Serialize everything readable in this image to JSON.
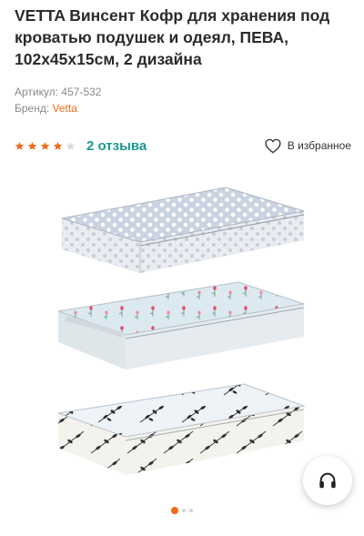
{
  "product": {
    "title": "VETTA Винсент Кофр для хранения под кроватью подушек и одеял, ПЕВА, 102х45х15см, 2 дизайна",
    "article_label": "Артикул:",
    "article_value": "457-532",
    "brand_label": "Бренд:",
    "brand_value": "Vetta"
  },
  "rating": {
    "value": 4,
    "max": 5,
    "reviews_text": "2 отзыва"
  },
  "favorite": {
    "label": "В избранное",
    "icon": "heart-outline-icon"
  },
  "gallery": {
    "image_count": 3,
    "active_index": 0
  },
  "support": {
    "icon": "headphones-icon"
  },
  "colors": {
    "accent": "#f06a1a",
    "link": "#1a9a8e",
    "star_filled": "#f06a1a",
    "star_empty": "#d9d9d9"
  }
}
